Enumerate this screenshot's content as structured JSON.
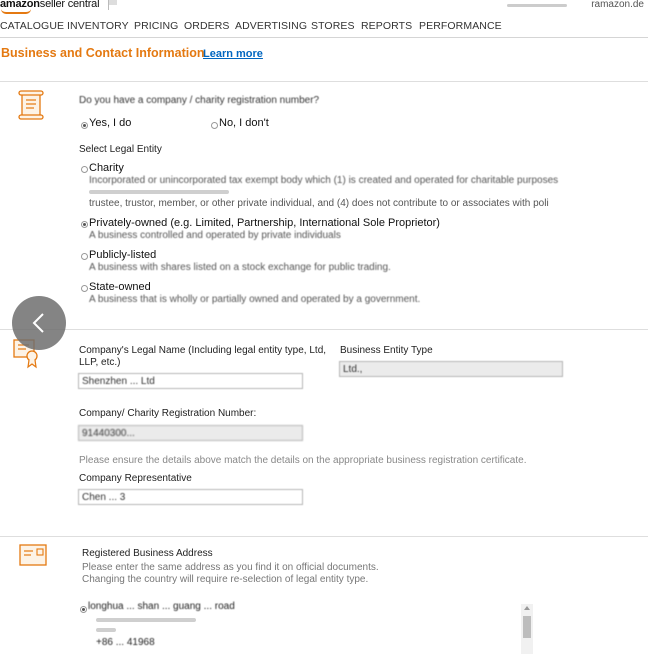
{
  "header": {
    "logo_brand": "amazon",
    "logo_product": "seller central",
    "right_text": "ramazon.de"
  },
  "nav": {
    "items": [
      "CATALOGUE",
      "INVENTORY",
      "PRICING",
      "ORDERS",
      "ADVERTISING",
      "STORES",
      "REPORTS",
      "PERFORMANCE"
    ]
  },
  "page": {
    "title": "Business and Contact Information",
    "learn_more": "Learn more"
  },
  "charity_section": {
    "question": "Do you have a company / charity registration number?",
    "yes_label": "Yes, I do",
    "no_label": "No, I don't",
    "selected": "yes",
    "legal_entity_label": "Select Legal Entity",
    "entities": [
      {
        "label": "Charity",
        "desc": "Incorporated or unincorporated tax exempt body which (1) is created and operated for charitable purposes",
        "desc2": "trustee, trustor, member, or other private individual, and (4) does not contribute to or associates with poli",
        "selected": false
      },
      {
        "label": "Privately-owned (e.g. Limited, Partnership, International Sole Proprietor)",
        "desc": "A business controlled and operated by private individuals",
        "selected": true
      },
      {
        "label": "Publicly-listed",
        "desc": "A business with shares listed on a stock exchange for public trading.",
        "selected": false
      },
      {
        "label": "State-owned",
        "desc": "A business that is wholly or partially owned and operated by a government.",
        "selected": false
      }
    ]
  },
  "company_section": {
    "legal_name_label": "Company's Legal Name (Including legal entity type, Ltd, LLP, etc.)",
    "legal_name_value": "Shenzhen ... Ltd",
    "entity_type_label": "Business Entity Type",
    "entity_type_value": "Ltd.,",
    "reg_number_label": "Company/ Charity Registration Number:",
    "reg_number_value": "91440300...",
    "ensure_hint": "Please ensure the details above match the details on the appropriate business registration certificate.",
    "rep_label": "Company Representative",
    "rep_value": "Chen ... 3"
  },
  "address_section": {
    "title": "Registered Business Address",
    "hint1": "Please enter the same address as you find it on official documents.",
    "hint2": "Changing the country will require re-selection of legal entity type.",
    "address_line": "longhua ... shan ... guang ... road",
    "phone": "+86 ... 41968"
  },
  "icons": {
    "doc": "document-icon",
    "certificate": "certificate-icon",
    "address": "address-card-icon",
    "back": "chevron-left-icon"
  },
  "colors": {
    "accent": "#e47911",
    "link": "#0066c0"
  }
}
